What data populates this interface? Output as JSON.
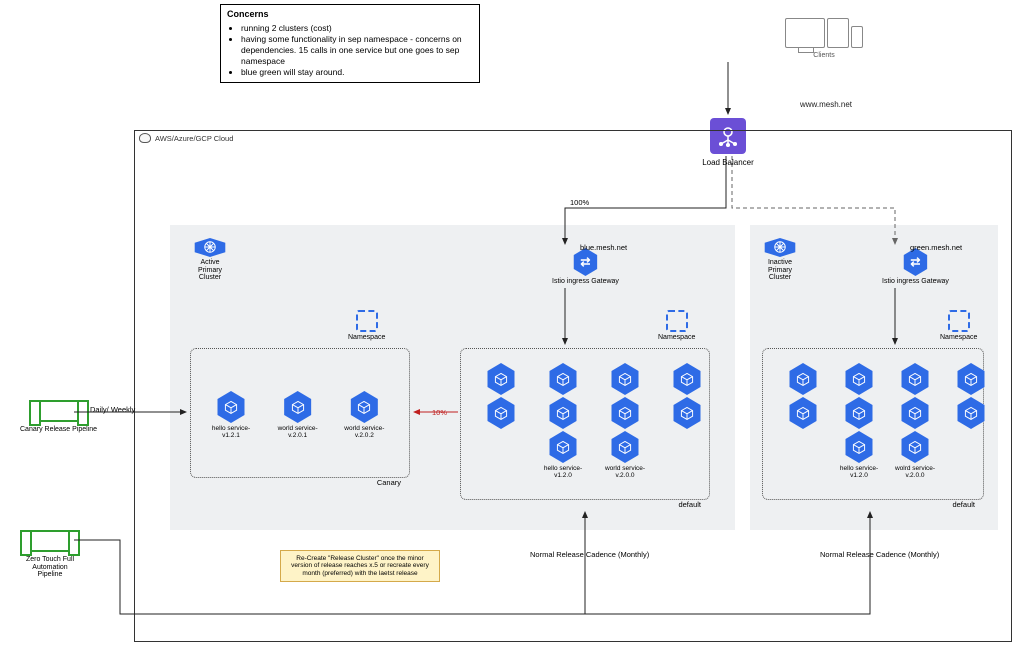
{
  "concerns": {
    "title": "Concerns",
    "items": [
      "running 2 clusters (cost)",
      "having some functionality in sep namespace - concerns on dependencies. 15 calls in one service but one goes to sep namespace",
      "blue green will stay around."
    ]
  },
  "clients_label": "Clients",
  "mesh_url": "www.mesh.net",
  "load_balancer_label": "Load Balancer",
  "traffic_100": "100%",
  "traffic_10": "10%",
  "cloud_title": "AWS/Azure/GCP Cloud",
  "clusters": {
    "active": {
      "label": "Active Primary Cluster"
    },
    "inactive": {
      "label": "Inactive Primary Cluster"
    }
  },
  "istio": {
    "blue": {
      "url": "blue.mesh.net",
      "label": "Istio ingress Gateway"
    },
    "green": {
      "url": "green.mesh.net",
      "label": "Istio ingress Gateway"
    }
  },
  "namespace_label": "Namespace",
  "ns": {
    "canary": "Canary",
    "default_a": "default",
    "default_b": "default"
  },
  "services": {
    "canary": [
      {
        "label": "hello service-v1.2.1"
      },
      {
        "label": "world service-v.2.0.1"
      },
      {
        "label": "world service-v.2.0.2"
      }
    ],
    "default_a_bottom": [
      {
        "label": "hello service-v1.2.0"
      },
      {
        "label": "world service-v.2.0.0"
      }
    ],
    "default_b_bottom": [
      {
        "label": "hello service-v1.2.0"
      },
      {
        "label": "wolrd service-v.2.0.0"
      }
    ]
  },
  "pipelines": {
    "canary": "Canary Release Pipeline",
    "zero": "Zero Touch Full Automation Pipeline",
    "daily": "Daily/ Weekly"
  },
  "cadence": "Normal Release Cadence (Monthly)",
  "note": "Re-Create \"Release Cluster\" once the minor version of release reaches x.5 or recreate every month (preferred) with the laetst release"
}
